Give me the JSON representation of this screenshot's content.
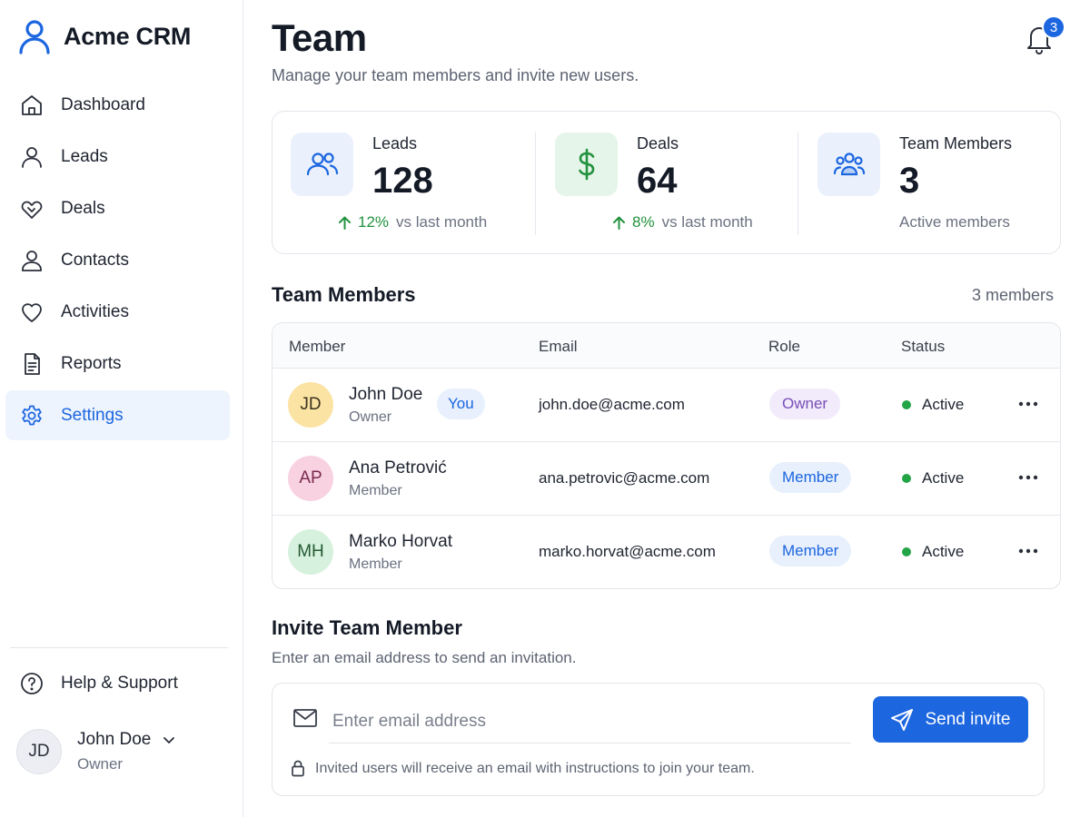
{
  "app": {
    "name": "Acme CRM"
  },
  "sidebar": {
    "items": [
      {
        "label": "Dashboard",
        "icon": "home-icon",
        "active": false
      },
      {
        "label": "Leads",
        "icon": "user-icon",
        "active": false
      },
      {
        "label": "Deals",
        "icon": "handshake-icon",
        "active": false
      },
      {
        "label": "Contacts",
        "icon": "contact-icon",
        "active": false
      },
      {
        "label": "Activities",
        "icon": "heart-icon",
        "active": false
      },
      {
        "label": "Reports",
        "icon": "document-icon",
        "active": false
      },
      {
        "label": "Settings",
        "icon": "gear-icon",
        "active": true
      }
    ],
    "help_label": "Help & Support",
    "user": {
      "initials": "JD",
      "name": "John Doe",
      "role": "Owner"
    }
  },
  "header": {
    "title": "Team",
    "subtitle": "Manage your team members and invite new users.",
    "notifications_count": "3"
  },
  "stats": [
    {
      "label": "Leads",
      "value": "128",
      "change": "12%",
      "change_suffix": "vs last month",
      "icon": "users-icon"
    },
    {
      "label": "Deals",
      "value": "64",
      "change": "8%",
      "change_suffix": "vs last month",
      "icon": "dollar-icon"
    },
    {
      "label": "Team Members",
      "value": "3",
      "note": "Active members",
      "icon": "team-icon"
    }
  ],
  "team": {
    "title": "Team Members",
    "count_label": "3 members",
    "columns": [
      "Member",
      "Email",
      "Role",
      "Status"
    ],
    "you_badge": "You",
    "rows": [
      {
        "initials": "JD",
        "name": "John Doe",
        "subrole": "Owner",
        "email": "john.doe@acme.com",
        "role": "Owner",
        "status": "Active",
        "avatar_bg": "#fbe3a3",
        "avatar_fg": "#3b3320"
      },
      {
        "initials": "AP",
        "name": "Ana Petrović",
        "subrole": "Member",
        "email": "ana.petrovic@acme.com",
        "role": "Member",
        "status": "Active",
        "avatar_bg": "#f9d2e2",
        "avatar_fg": "#7a2a4d"
      },
      {
        "initials": "MH",
        "name": "Marko Horvat",
        "subrole": "Member",
        "email": "marko.horvat@acme.com",
        "role": "Member",
        "status": "Active",
        "avatar_bg": "#d6f1dd",
        "avatar_fg": "#245a33"
      }
    ]
  },
  "invite": {
    "title": "Invite Team Member",
    "subtitle": "Enter an email address to send an invitation.",
    "input_placeholder": "Enter email address",
    "button_label": "Send invite",
    "note": "Invited users will receive an email with instructions to join your team."
  },
  "colors": {
    "accent": "#1c66e0",
    "positive": "#21923e",
    "status_active": "#22a447",
    "icon_bg_blue": "#eaf1fd",
    "icon_bg_green": "#e6f5e9"
  }
}
